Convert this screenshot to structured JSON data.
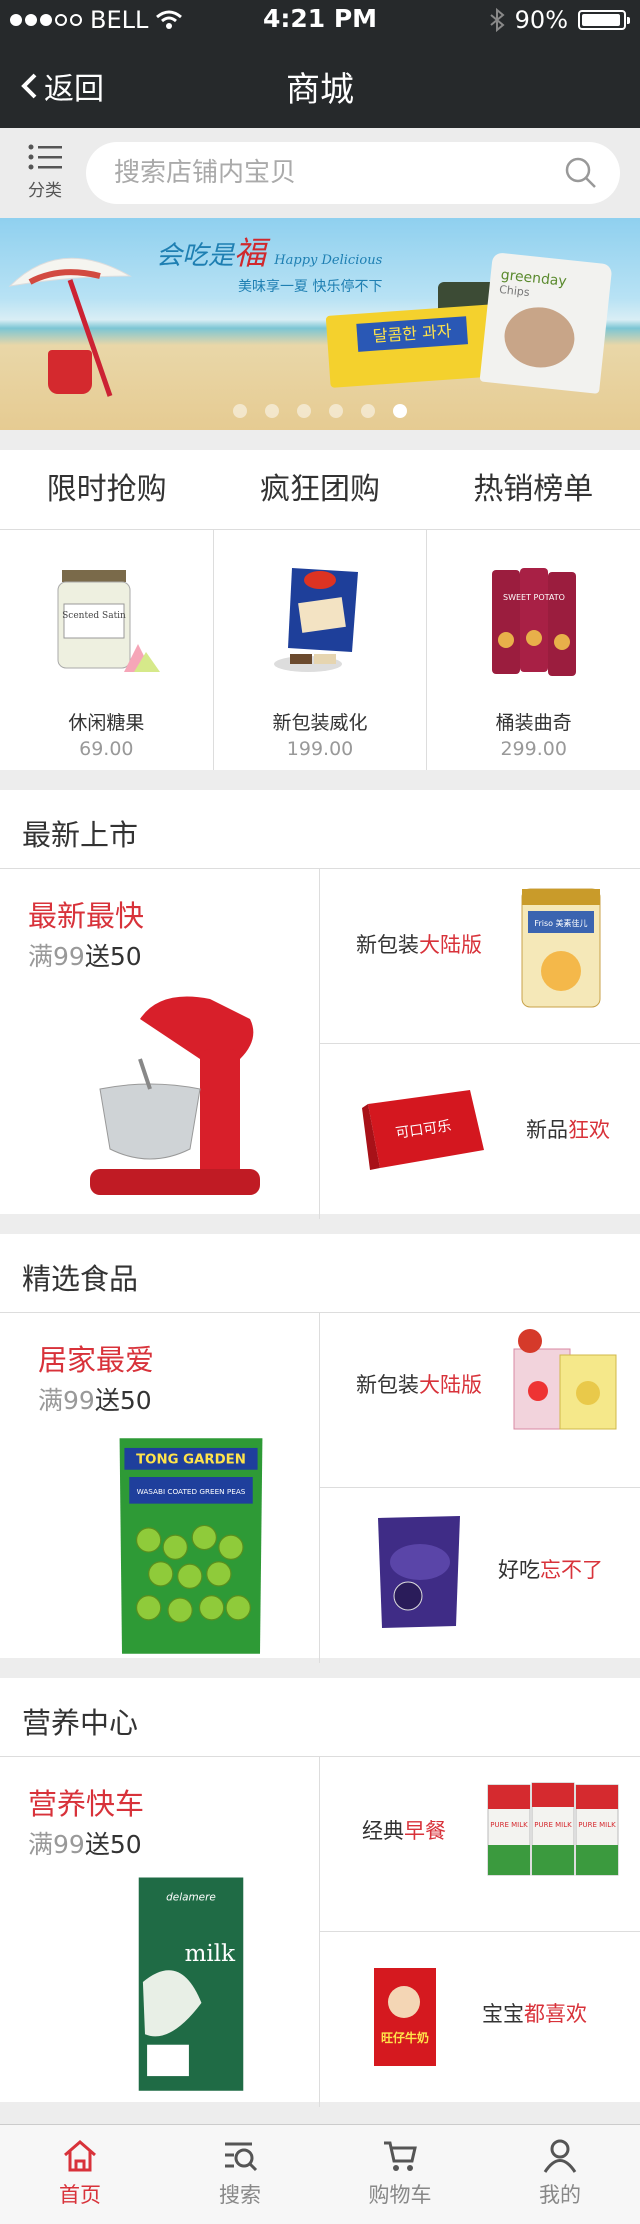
{
  "status_bar": {
    "carrier": "BELL",
    "time": "4:21 PM",
    "battery": "90%"
  },
  "nav": {
    "back_label": "返回",
    "title": "商城"
  },
  "search": {
    "category_label": "分类",
    "placeholder": "搜索店铺内宝贝"
  },
  "banner": {
    "slogan_a": "会吃是",
    "slogan_b": "福",
    "slogan_c": "Happy Delicious",
    "sub_line": "美味享一夏  快乐停不下",
    "bag_label": "greenday",
    "bag_sub": "Chips",
    "box_label": "달콤한 과자",
    "page_count": 6,
    "active_page": 5
  },
  "tabs": [
    "限时抢购",
    "疯狂团购",
    "热销榜单"
  ],
  "products": [
    {
      "name": "休闲糖果",
      "price": "69.00",
      "jar_label": "Scented Satin"
    },
    {
      "name": "新包装威化",
      "price": "199.00"
    },
    {
      "name": "桶装曲奇",
      "price": "299.00",
      "can_label": "SWEET POTATO"
    }
  ],
  "sections": [
    {
      "title": "最新上市",
      "big": {
        "title": "最新最快",
        "sub_gray": "满99",
        "sub_black": "送50"
      },
      "top": {
        "text": "新包装",
        "red": "大陆版",
        "can_brand": "Friso 美素佳儿"
      },
      "bottom": {
        "text": "新品",
        "red": "狂欢",
        "box_brand": "可口可乐"
      }
    },
    {
      "title": "精选食品",
      "big": {
        "title": "居家最爱",
        "sub_gray": "满99",
        "sub_black": "送50",
        "bag_brand": "TONG GARDEN",
        "bag_line": "WASABI COATED GREEN PEAS"
      },
      "top": {
        "text": "新包装",
        "red": "大陆版"
      },
      "bottom": {
        "text": "好吃",
        "red": "忘不了"
      }
    },
    {
      "title": "营养中心",
      "big": {
        "title": "营养快车",
        "sub_gray": "满99",
        "sub_black": "送50",
        "carton_brand": "delamere",
        "carton_word": "milk"
      },
      "top": {
        "text": "经典",
        "red": "早餐",
        "carton_word": "PURE MILK"
      },
      "bottom": {
        "text": "宝宝",
        "red": "都喜欢",
        "box_brand": "旺仔牛奶"
      }
    }
  ],
  "tabbar": [
    {
      "label": "首页",
      "icon": "home-icon",
      "active": true
    },
    {
      "label": "搜索",
      "icon": "search-list-icon",
      "active": false
    },
    {
      "label": "购物车",
      "icon": "cart-icon",
      "active": false
    },
    {
      "label": "我的",
      "icon": "user-icon",
      "active": false
    }
  ],
  "colors": {
    "nav_bg": "#26292b",
    "accent": "#d8323a"
  }
}
